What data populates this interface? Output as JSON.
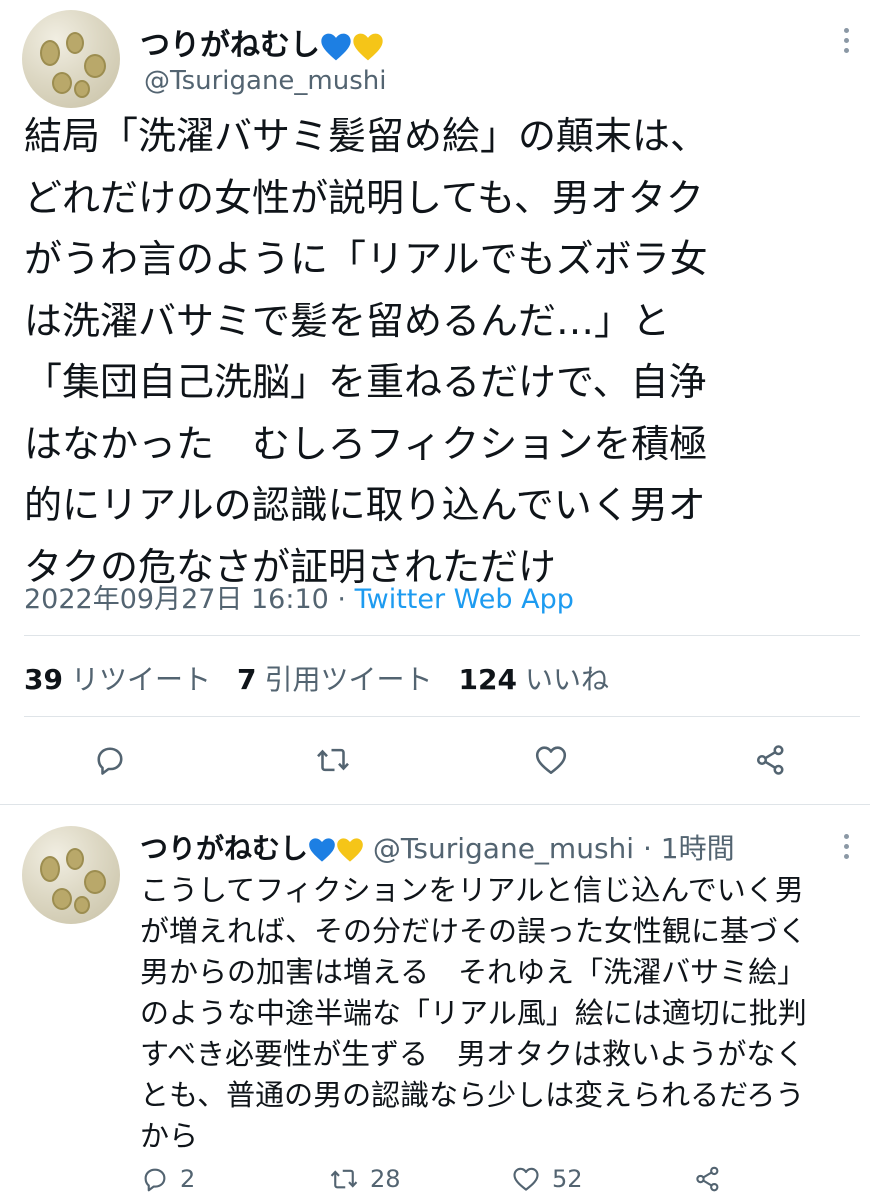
{
  "tweet": {
    "display_name": "つりがねむし",
    "handle": "@Tsurigane_mushi",
    "hearts": [
      "blue-heart",
      "yellow-heart"
    ],
    "text": "結局「洗濯バサミ髪留め絵」の顛末は、\nどれだけの女性が説明しても、男オタク\nがうわ言のように「リアルでもズボラ女\nは洗濯バサミで髪を留めるんだ…」と\n「集団自己洗脳」を重ねるだけで、自浄\nはなかった　むしろフィクションを積極\n的にリアルの認識に取り込んでいく男オ\nタクの危なさが証明されただけ",
    "timestamp": "2022年09月27日 16:10",
    "separator": "·",
    "source": "Twitter Web App",
    "stats": {
      "retweets_count": "39",
      "retweets_label": "リツイート",
      "quotes_count": "7",
      "quotes_label": "引用ツイート",
      "likes_count": "124",
      "likes_label": "いいね"
    },
    "icons": [
      "reply-icon",
      "retweet-icon",
      "like-icon",
      "share-icon"
    ]
  },
  "reply": {
    "display_name": "つりがねむし",
    "handle": "@Tsurigane_mushi",
    "separator": "·",
    "time": "1時間",
    "text": "こうしてフィクションをリアルと信じ込んでいく男\nが増えれば、その分だけその誤った女性観に基づく\n男からの加害は増える　それゆえ「洗濯バサミ絵」\nのような中途半端な「リアル風」絵には適切に批判\nすべき必要性が生ずる　男オタクは救いようがなく\nとも、普通の男の認識なら少しは変えられるだろう\nから",
    "reply_count": "2",
    "retweet_count": "28",
    "like_count": "52"
  },
  "colors": {
    "text": "#0f1419",
    "secondary": "#536471",
    "link": "#1d9bf0",
    "divider": "#dfe4e8",
    "blue_heart": "#1d7fe3",
    "yellow_heart": "#f5c518"
  }
}
